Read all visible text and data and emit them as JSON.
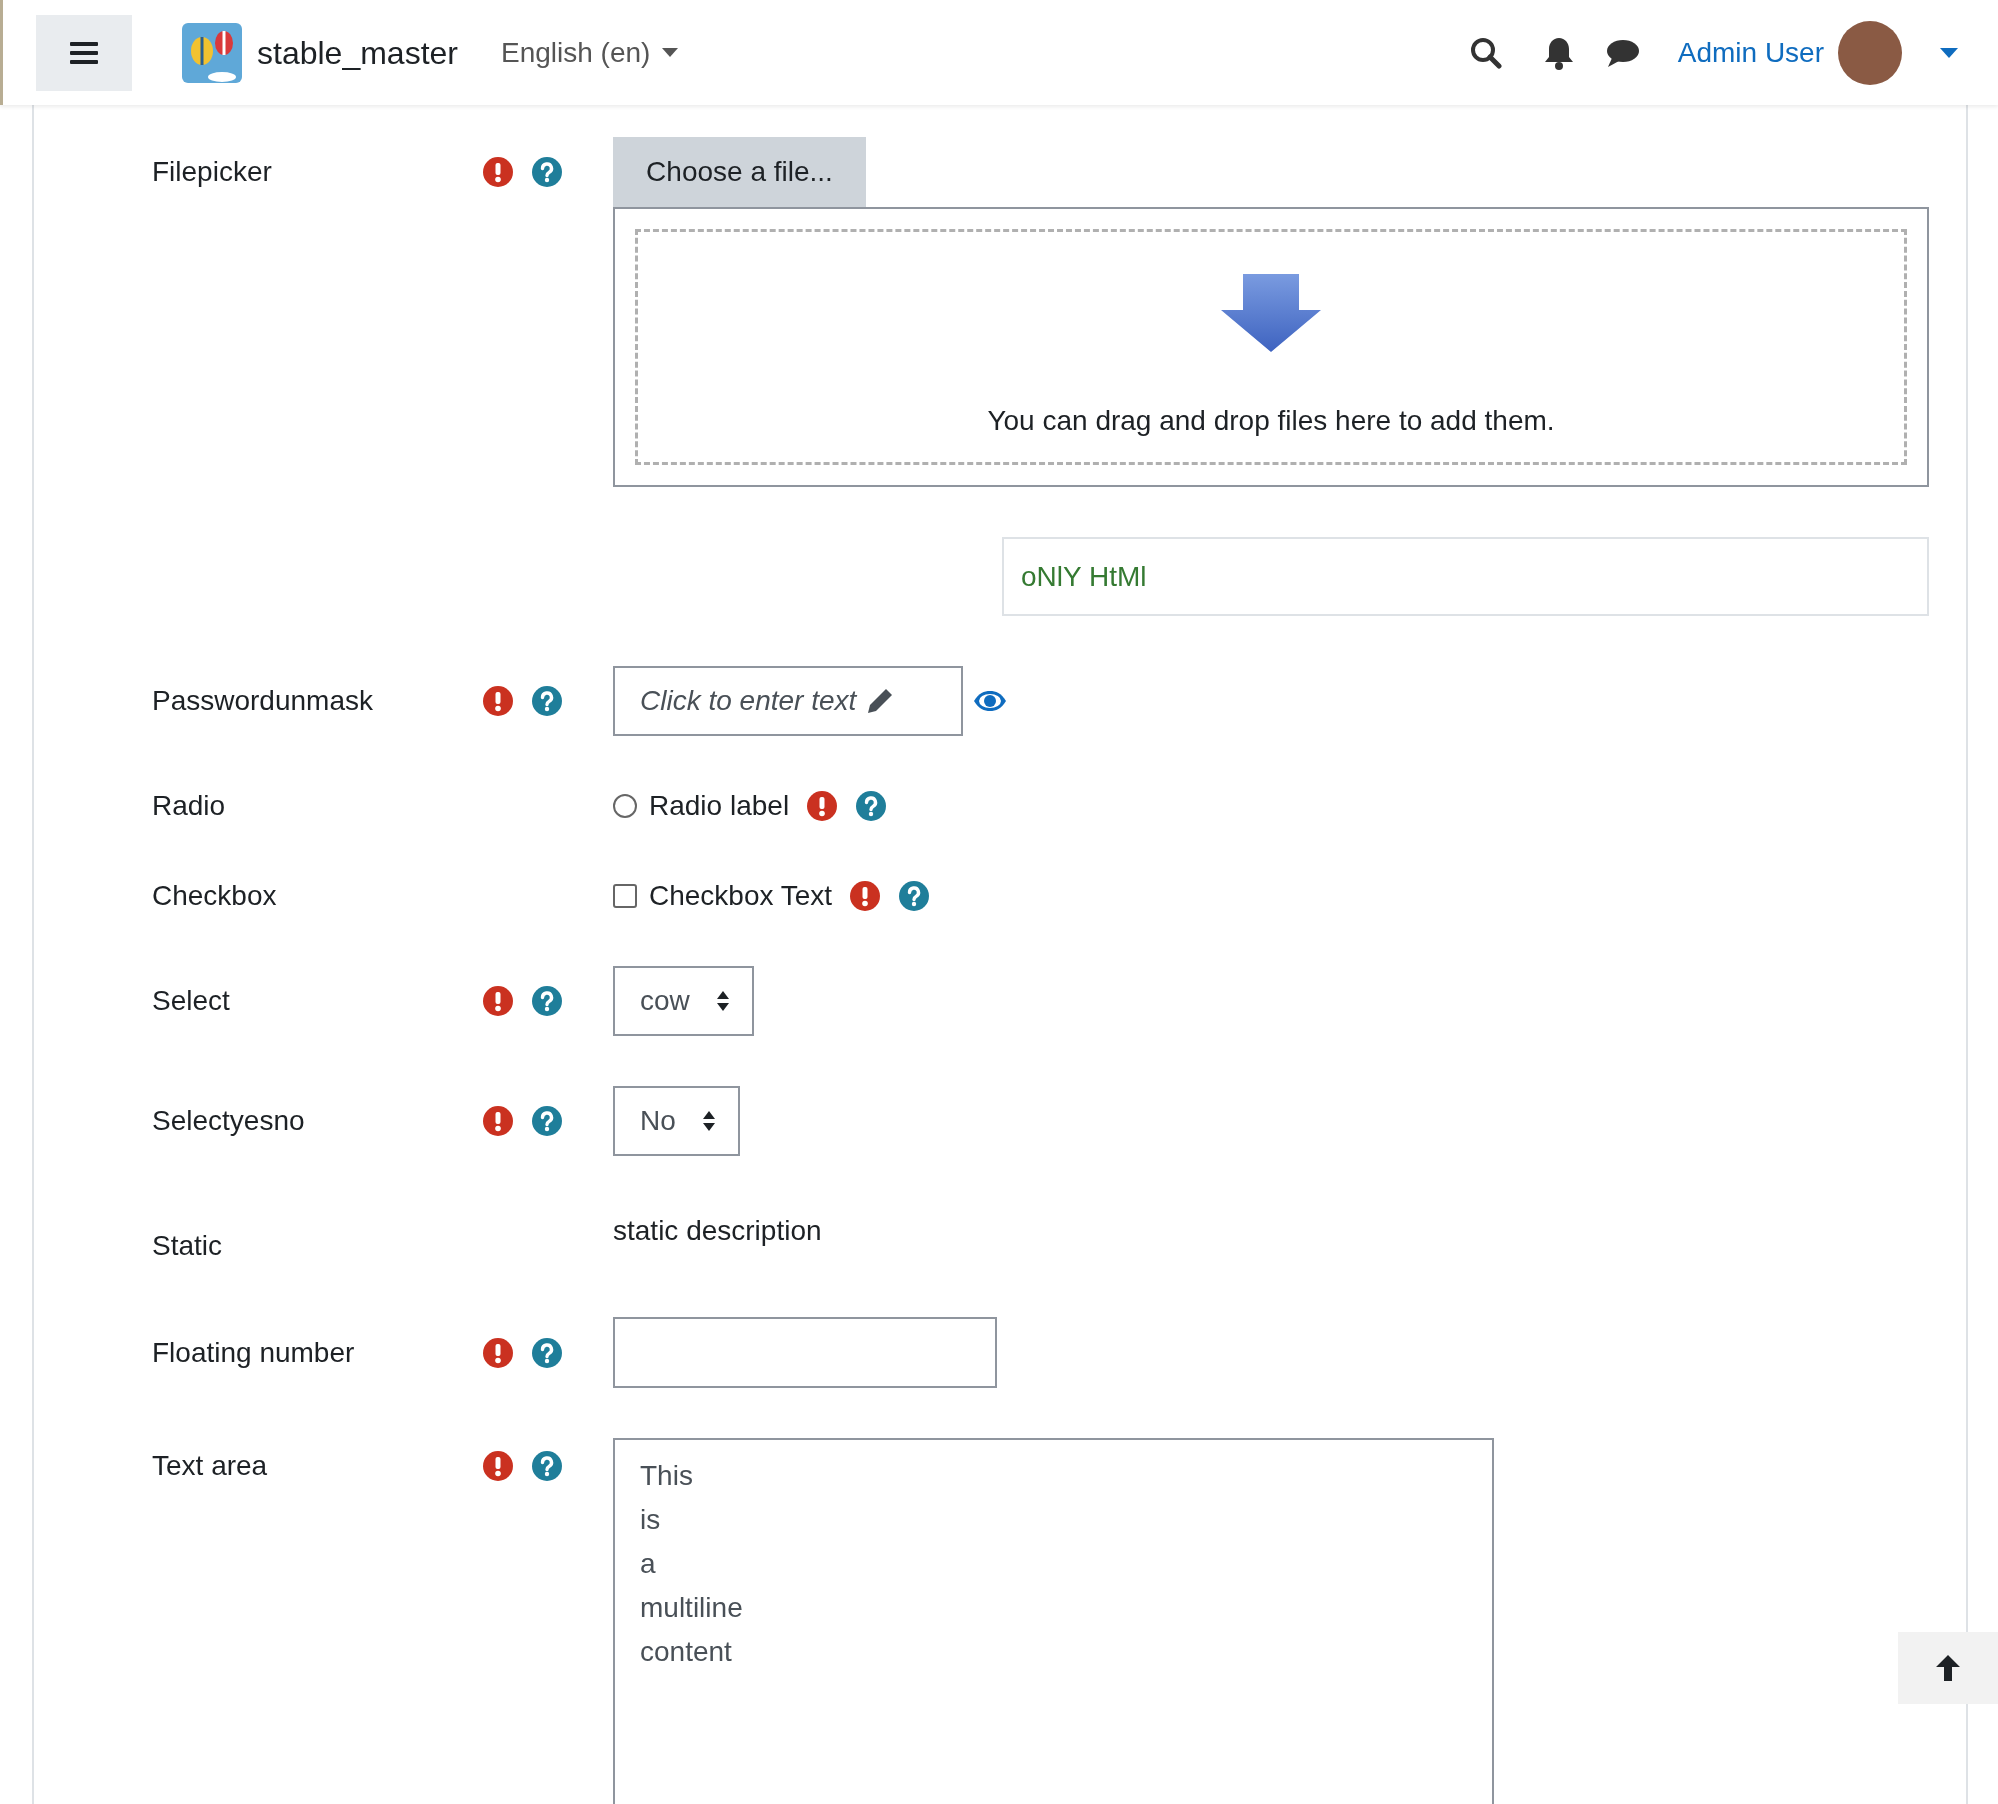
{
  "header": {
    "site_name": "stable_master",
    "language": "English (en)",
    "user_name": "Admin User"
  },
  "fields": [
    {
      "kind": "filepicker",
      "label": "Filepicker",
      "required": true,
      "help": true,
      "button": "Choose a file...",
      "drop_text": "You can drag and drop files here to add them.",
      "note": "oNlY HtMl"
    },
    {
      "kind": "password",
      "label": "Passwordunmask",
      "required": true,
      "help": true,
      "prompt": "Click to enter text"
    },
    {
      "kind": "radio",
      "label": "Radio",
      "required": true,
      "help": true,
      "option": "Radio label",
      "checked": false
    },
    {
      "kind": "checkbox",
      "label": "Checkbox",
      "required": true,
      "help": true,
      "option": "Checkbox Text",
      "checked": false
    },
    {
      "kind": "select",
      "label": "Select",
      "required": true,
      "help": true,
      "value": "cow"
    },
    {
      "kind": "select",
      "label": "Selectyesno",
      "required": true,
      "help": true,
      "value": "No"
    },
    {
      "kind": "static",
      "label": "Static",
      "required": false,
      "help": false,
      "text": "static description"
    },
    {
      "kind": "number",
      "label": "Floating number",
      "required": true,
      "help": true
    },
    {
      "kind": "textarea",
      "label": "Text area",
      "required": true,
      "help": true,
      "lines": [
        "This",
        "is",
        "a",
        "multiline",
        "content"
      ]
    }
  ]
}
